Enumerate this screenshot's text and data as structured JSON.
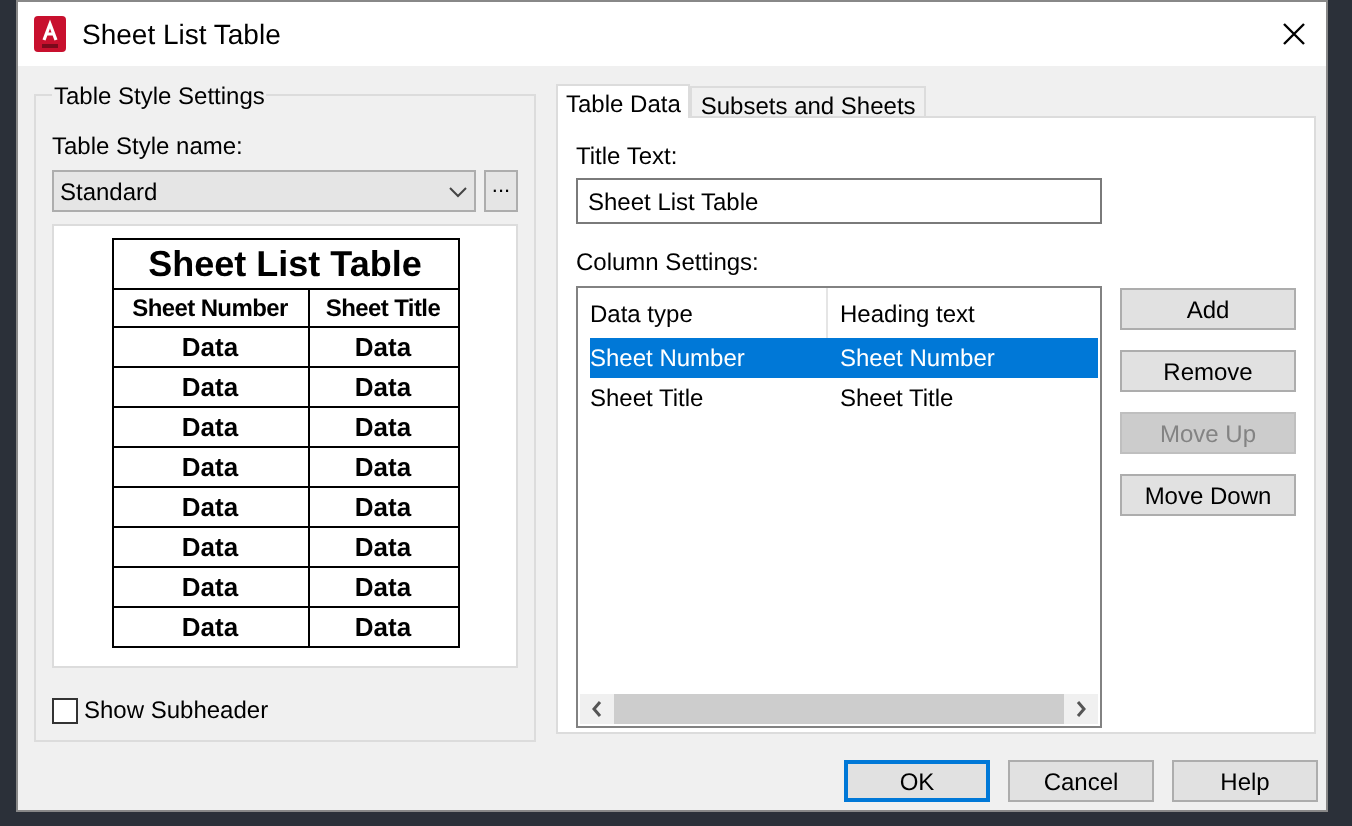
{
  "window": {
    "title": "Sheet List Table"
  },
  "table_style_settings": {
    "legend": "Table Style Settings",
    "name_label": "Table Style name:",
    "style_dropdown": {
      "value": "Standard"
    },
    "browse_button": "...",
    "preview": {
      "title": "Sheet List Table",
      "headers": [
        "Sheet Number",
        "Sheet Title"
      ],
      "rows": [
        [
          "Data",
          "Data"
        ],
        [
          "Data",
          "Data"
        ],
        [
          "Data",
          "Data"
        ],
        [
          "Data",
          "Data"
        ],
        [
          "Data",
          "Data"
        ],
        [
          "Data",
          "Data"
        ],
        [
          "Data",
          "Data"
        ],
        [
          "Data",
          "Data"
        ]
      ]
    },
    "show_subheader": {
      "label": "Show Subheader",
      "checked": false
    }
  },
  "tabs": [
    {
      "label": "Table Data",
      "selected": true
    },
    {
      "label": "Subsets and Sheets",
      "selected": false
    }
  ],
  "title_text": {
    "label": "Title Text:",
    "value": "Sheet List Table"
  },
  "column_settings": {
    "label": "Column Settings:",
    "columns": [
      "Data type",
      "Heading text"
    ],
    "rows": [
      {
        "data_type": "Sheet Number",
        "heading": "Sheet Number",
        "selected": true
      },
      {
        "data_type": "Sheet Title",
        "heading": "Sheet Title",
        "selected": false
      }
    ]
  },
  "side_buttons": [
    {
      "label": "Add",
      "disabled": false
    },
    {
      "label": "Remove",
      "disabled": false
    },
    {
      "label": "Move Up",
      "disabled": true
    },
    {
      "label": "Move Down",
      "disabled": false
    }
  ],
  "footer_buttons": [
    {
      "label": "OK",
      "default": true
    },
    {
      "label": "Cancel",
      "default": false
    },
    {
      "label": "Help",
      "default": false
    }
  ]
}
